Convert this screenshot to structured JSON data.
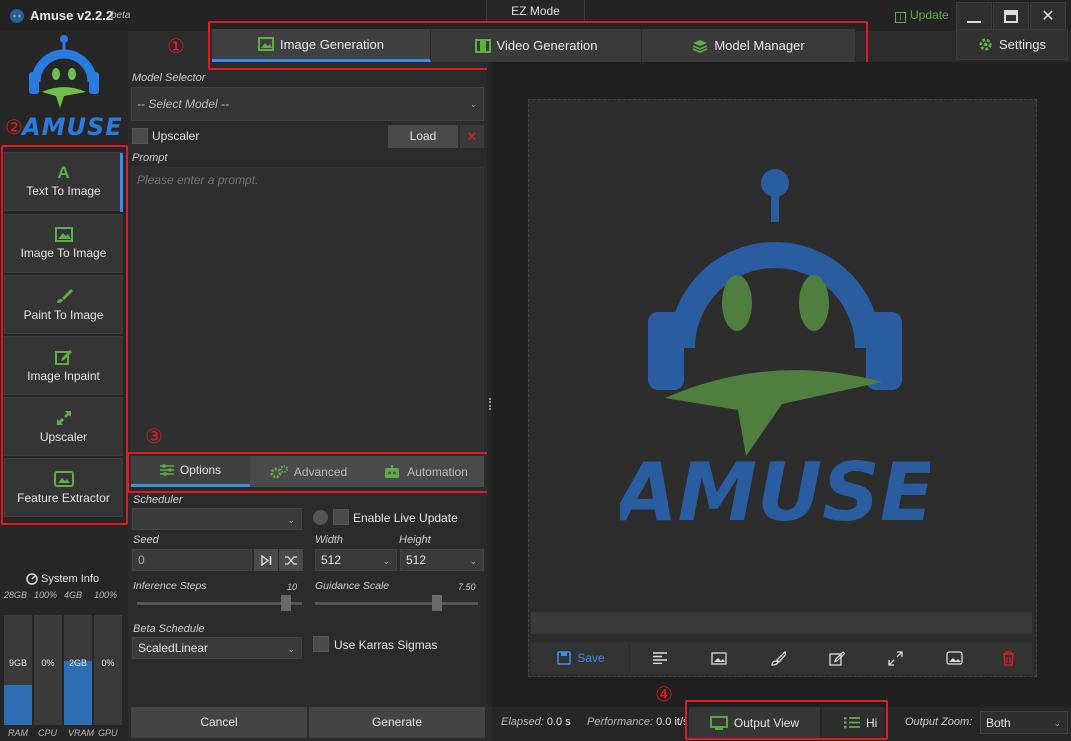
{
  "app": {
    "title": "Amuse v2.2.2",
    "beta": "beta",
    "mode": "EZ Mode",
    "update": "Update",
    "settings": "Settings",
    "logo_text": "AMUSE"
  },
  "main_tabs": [
    {
      "label": "Image Generation",
      "icon": "image-icon"
    },
    {
      "label": "Video Generation",
      "icon": "film-icon"
    },
    {
      "label": "Model Manager",
      "icon": "layers-icon"
    }
  ],
  "annotations": [
    "①",
    "②",
    "③",
    "④"
  ],
  "sidebar": {
    "items": [
      {
        "label": "Text To Image",
        "icon": "letter-a-icon"
      },
      {
        "label": "Image To Image",
        "icon": "image-icon"
      },
      {
        "label": "Paint To Image",
        "icon": "brush-icon"
      },
      {
        "label": "Image Inpaint",
        "icon": "edit-icon"
      },
      {
        "label": "Upscaler",
        "icon": "expand-icon"
      },
      {
        "label": "Feature Extractor",
        "icon": "photo-icon"
      }
    ]
  },
  "system_info": {
    "title": "System Info",
    "meters": [
      {
        "top": "28GB",
        "value": "9GB",
        "bottom": "RAM",
        "fill": 0.36
      },
      {
        "top": "100%",
        "value": "0%",
        "bottom": "CPU",
        "fill": 0
      },
      {
        "top": "4GB",
        "value": "2GB",
        "bottom": "VRAM",
        "fill": 0.58
      },
      {
        "top": "100%",
        "value": "0%",
        "bottom": "GPU",
        "fill": 0
      }
    ]
  },
  "model": {
    "label": "Model Selector",
    "placeholder": "-- Select Model --",
    "upscaler": "Upscaler",
    "load": "Load"
  },
  "prompt": {
    "label": "Prompt",
    "placeholder": "Please enter a prompt."
  },
  "sub_tabs": [
    {
      "label": "Options"
    },
    {
      "label": "Advanced"
    },
    {
      "label": "Automation"
    }
  ],
  "options": {
    "scheduler_label": "Scheduler",
    "live_update": "Enable Live Update",
    "seed_label": "Seed",
    "seed_value": "0",
    "width_label": "Width",
    "width_value": "512",
    "height_label": "Height",
    "height_value": "512",
    "steps_label": "Inference Steps",
    "steps_value": "10",
    "steps_fraction": 0.9,
    "guidance_label": "Guidance Scale",
    "guidance_value": "7.50",
    "guidance_fraction": 0.75,
    "beta_label": "Beta Schedule",
    "beta_value": "ScaledLinear",
    "karras": "Use Karras Sigmas"
  },
  "actions": {
    "cancel": "Cancel",
    "generate": "Generate"
  },
  "toolbar": {
    "save": "Save"
  },
  "status": {
    "elapsed_label": "Elapsed:",
    "elapsed_value": "0.0 s",
    "perf_label": "Performance:",
    "perf_value": "0.0 it/s",
    "output_view": "Output View",
    "history": "Hi",
    "zoom_label": "Output Zoom:",
    "zoom_value": "Both"
  },
  "colors": {
    "accent": "#3a8ee6",
    "green_icon": "#5fae47",
    "annotation": "#e01b24",
    "logo_blue": "#2a5d9f",
    "logo_green": "#4f7e3e"
  }
}
